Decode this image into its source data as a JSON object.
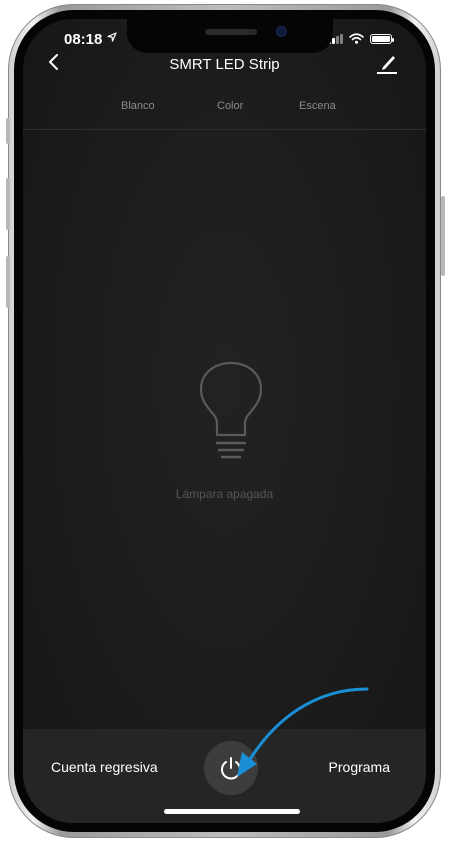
{
  "status_bar": {
    "time": "08:18",
    "location_icon": "location-arrow-icon",
    "signal_icon": "cellular-signal-icon",
    "wifi_icon": "wifi-icon",
    "battery_icon": "battery-icon"
  },
  "header": {
    "back_icon": "chevron-left-icon",
    "title": "SMRT LED Strip",
    "edit_icon": "pencil-edit-icon"
  },
  "tabs": [
    {
      "label": "Blanco"
    },
    {
      "label": "Color"
    },
    {
      "label": "Escena"
    }
  ],
  "main": {
    "bulb_icon": "lightbulb-icon",
    "status_text": "Lámpara apagada"
  },
  "bottom_bar": {
    "countdown_label": "Cuenta regresiva",
    "power_icon": "power-icon",
    "schedule_label": "Programa"
  },
  "annotation": {
    "arrow_color": "#1a8fd6"
  },
  "colors": {
    "background": "#1c1c1c",
    "tab_text": "#8a8a8a",
    "status_text": "#555555",
    "bottom_bar": "#252525",
    "power_button": "#3d3d3d"
  }
}
